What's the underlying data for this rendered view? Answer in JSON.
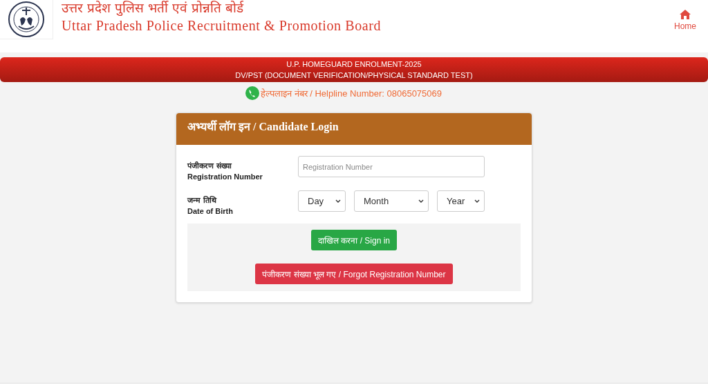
{
  "header": {
    "title_hindi": "उत्तर प्रदेश पुलिस भर्ती एवं प्रोन्नति बोर्ड",
    "title_english": "Uttar Pradesh Police Recruitment & Promotion Board",
    "home_link": "Home"
  },
  "banner": {
    "lines": [
      "U.P. HOMEGUARD ENROLMENT-2025",
      "DV/PST (DOCUMENT VERIFICATION/PHYSICAL STANDARD TEST)"
    ]
  },
  "helpline": "हेल्पलाइन नंबर / Helpline Number: 08065075069",
  "login": {
    "title": "अभ्यर्थी लॉग इन / Candidate Login",
    "registration": {
      "label_hindi": "पंजीकरण संख्या",
      "label_english": "Registration Number",
      "placeholder": "Registration Number"
    },
    "dob": {
      "label_hindi": "जन्म तिथि",
      "label_english": "Date of Birth",
      "dropdowns": [
        "Day",
        "Month",
        "Year"
      ]
    },
    "buttons": [
      {
        "kind": "primary",
        "label": "दाखिल करना / Sign in"
      },
      {
        "kind": "danger",
        "label": "पंजीकरण संख्या भूल गए / Forgot Registration Number"
      }
    ]
  }
}
